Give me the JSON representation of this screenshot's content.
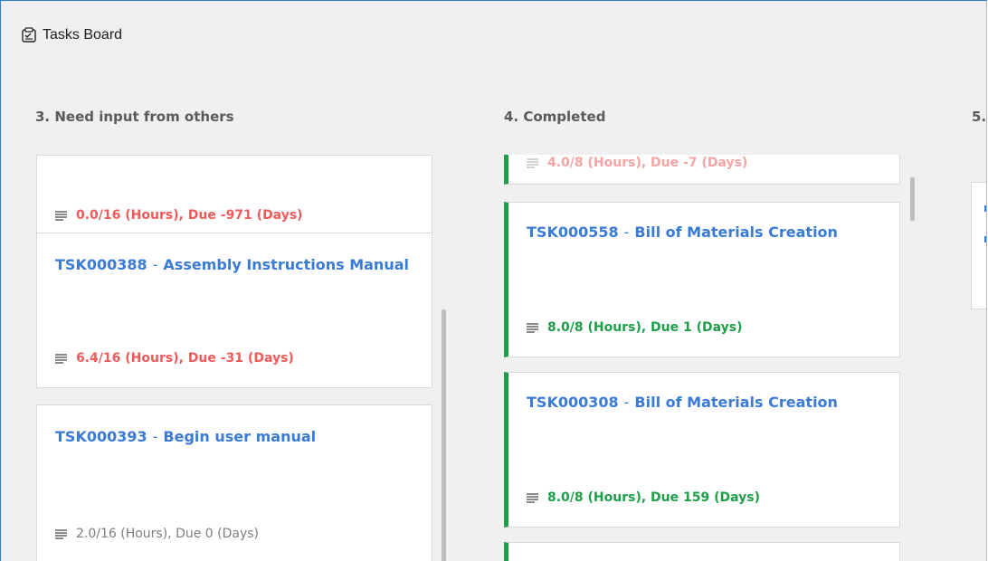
{
  "window": {
    "title": "Tasks Board",
    "icon": "tasks-board-app-icon"
  },
  "columns": [
    {
      "title": "3. Need input from others",
      "cards": [
        {
          "meta": "0.0/16 (Hours), Due -971 (Days)",
          "status": "red"
        },
        {
          "id": "TSK000388",
          "sep": "-",
          "name": "Assembly Instructions Manual",
          "meta": "6.4/16 (Hours), Due -31 (Days)",
          "status": "red"
        },
        {
          "id": "TSK000393",
          "sep": "-",
          "name": "Begin user manual",
          "meta": "2.0/16 (Hours), Due 0 (Days)",
          "status": "gray"
        }
      ]
    },
    {
      "title": "4. Completed",
      "cards": [
        {
          "meta": "4.0/8 (Hours), Due -7 (Days)",
          "status": "faded"
        },
        {
          "id": "TSK000558",
          "sep": "-",
          "name": "Bill of Materials Creation",
          "meta": "8.0/8 (Hours), Due 1 (Days)",
          "status": "green"
        },
        {
          "id": "TSK000308",
          "sep": "-",
          "name": "Bill of Materials Creation",
          "meta": "8.0/8 (Hours), Due 159 (Days)",
          "status": "green"
        }
      ]
    },
    {
      "title": "5."
    }
  ],
  "colors": {
    "accent_blue": "#3a7bd5",
    "overdue_red": "#ef5a5a",
    "complete_green": "#1f9e4a",
    "neutral_gray": "#7e7e7e",
    "window_bg": "#f0f0f0"
  }
}
